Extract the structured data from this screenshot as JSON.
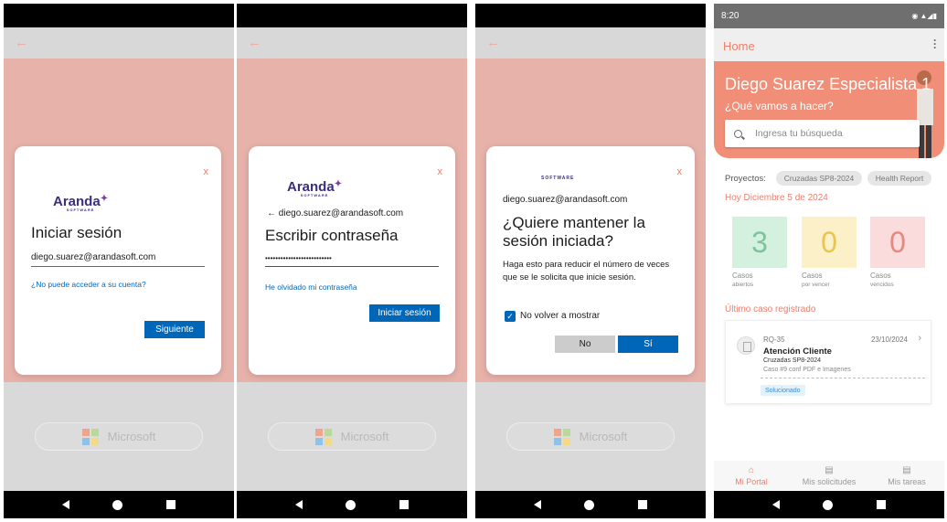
{
  "screens": {
    "login": {
      "logo": "Aranda",
      "logo_sub": "SOFTWARE",
      "close": "x",
      "title": "Iniciar sesión",
      "email_value": "diego.suarez@arandasoft.com",
      "link": "¿No puede acceder a su cuenta?",
      "next_button": "Siguiente",
      "microsoft_button": "Microsoft"
    },
    "password": {
      "logo": "Aranda",
      "logo_sub": "SOFTWARE",
      "close": "x",
      "back_arrow": "←",
      "identity": "diego.suarez@arandasoft.com",
      "title": "Escribir contraseña",
      "password_mask": "••••••••••••••••••••••••••",
      "forgot_link": "He olvidado mi contraseña",
      "signin_button": "Iniciar sesión",
      "microsoft_button": "Microsoft"
    },
    "stay_signed_in": {
      "logo_sub": "SOFTWARE",
      "close": "x",
      "identity": "diego.suarez@arandasoft.com",
      "title": "¿Quiere mantener la sesión iniciada?",
      "body": "Haga esto para reducir el número de veces que se le solicita que inicie sesión.",
      "checkbox_label": "No volver a mostrar",
      "no_button": "No",
      "yes_button": "Sí",
      "microsoft_button": "Microsoft"
    },
    "home": {
      "status_time": "8:20",
      "page_title": "Home",
      "greeting_name": "Diego Suarez Especialista 1",
      "greeting_question": "¿Qué vamos a hacer?",
      "search_placeholder": "Ingresa tu búsqueda",
      "projects_label": "Proyectos:",
      "projects": [
        "Cruzadas SP8-2024",
        "Health Report"
      ],
      "today": "Hoy Diciembre 5 de 2024",
      "stats": [
        {
          "value": "3",
          "label": "Casos",
          "sublabel": "abiertos",
          "bg": "#d4f0de",
          "fg": "#7cc49a"
        },
        {
          "value": "0",
          "label": "Casos",
          "sublabel": "por vencer",
          "bg": "#fbf0c8",
          "fg": "#e8c64e"
        },
        {
          "value": "0",
          "label": "Casos",
          "sublabel": "vencidos",
          "bg": "#f9dcdb",
          "fg": "#e8877f"
        }
      ],
      "last_case_label": "Último caso registrado",
      "last_case": {
        "code": "RQ-35",
        "date": "23/10/2024",
        "title": "Atención Cliente",
        "project": "Cruzadas SP8-2024",
        "description": "Caso #9 conf PDF e Imagenes",
        "status": "Solucionado"
      },
      "tabs": [
        {
          "label": "Mi Portal",
          "icon": "home-icon"
        },
        {
          "label": "Mis solicitudes",
          "icon": "document-icon"
        },
        {
          "label": "Mis tareas",
          "icon": "document-icon"
        }
      ]
    }
  },
  "colors": {
    "accent": "#ee7f6c",
    "ms_blue": "#0067b8"
  }
}
